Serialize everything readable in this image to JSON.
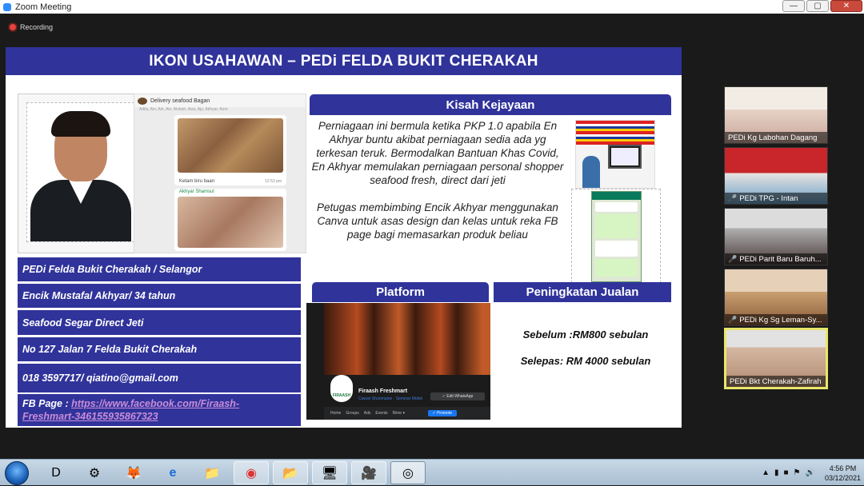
{
  "window": {
    "title": "Zoom Meeting",
    "buttons": [
      "—",
      "▢",
      "✕"
    ]
  },
  "recording": {
    "label": "Recording"
  },
  "slide": {
    "title": "IKON USAHAWAN – PEDi FELDA BUKIT CHERAKAH",
    "chat": {
      "header": "Delivery seafood Bagan",
      "members": "Adila, Ain, Ain, Ain, Aishah, Aiza, Aju, Akhyar, Aom",
      "caption": "Ketam biru baan",
      "time": "12:53 pm",
      "sender": "Akhyar Shamsul"
    },
    "info": {
      "line1": "PEDi Felda Bukit Cherakah / Selangor",
      "line2": "Encik Mustafal Akhyar/ 34 tahun",
      "line3": "Seafood Segar Direct Jeti",
      "line4": "No 127 Jalan 7 Felda Bukit Cherakah",
      "line5": "018 3597717/ qiatino@gmail.com",
      "fb_prefix": "FB Page : ",
      "fb_link_1": "https://www.facebook.com/Firaash-",
      "fb_link_2": "Freshmart-346155935867323"
    },
    "kisah": {
      "heading": "Kisah Kejayaan",
      "para1": "Perniagaan ini bermula ketika PKP 1.0 apabila En Akhyar buntu akibat perniagaan sedia ada yg terkesan teruk. Bermodalkan Bantuan Khas Covid, En Akhyar memulakan perniagaan personal shopper seafood fresh, direct dari jeti",
      "para2": "Petugas membimbing Encik Akhyar menggunakan Canva untuk asas design dan kelas untuk reka FB page bagi memasarkan produk beliau"
    },
    "platform": {
      "heading": "Platform",
      "fb_page_name": "Firaash Freshmart",
      "fb_page_sub": "Cawan Shanmaine · Seminar Mettel",
      "fb_logo_text": "FIRAASH",
      "fb_whatsapp": "✓ Edit WhatsApp",
      "fb_nav": [
        "Home",
        "Groups",
        "Ads",
        "Events",
        "More ▾"
      ],
      "fb_promote": "✓ Promote"
    },
    "jualan": {
      "heading": "Peningkatan Jualan",
      "before": "Sebelum :RM800 sebulan",
      "after": "Selepas: RM 4000 sebulan"
    }
  },
  "participants": [
    {
      "name": "PEDi Kg Labohan Dagang",
      "muted": false
    },
    {
      "name": "PEDi TPG - Intan",
      "muted": true
    },
    {
      "name": "PEDi Parit Baru Baruh...",
      "muted": true
    },
    {
      "name": "PEDi Kg Sg Leman-Sy...",
      "muted": true
    },
    {
      "name": "PEDi Bkt Cherakah-Zafirah",
      "muted": false,
      "active": true
    }
  ],
  "taskbar": {
    "apps": [
      "D",
      "⚙",
      "🦊",
      "e",
      "📁",
      "◉",
      "📂",
      "🖥",
      "🎥",
      "◎"
    ],
    "clock_time": "4:56 PM",
    "clock_date": "03/12/2021",
    "tray_arrow": "▲"
  },
  "colors": {
    "slide_header": "#30339a",
    "link": "#c98cd8",
    "active_speaker": "#e8e66a"
  }
}
